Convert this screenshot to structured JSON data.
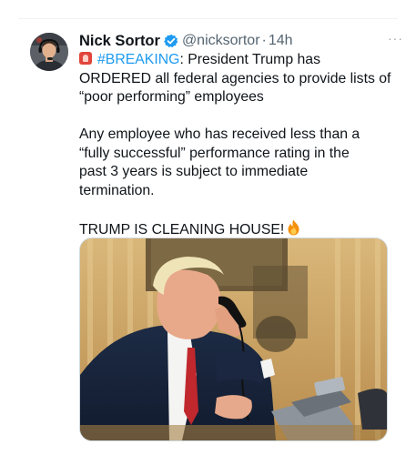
{
  "tweet": {
    "author_name": "Nick Sortor",
    "handle": "@nicksortor",
    "separator": "·",
    "time": "14h",
    "more": "···",
    "hashtag": "#BREAKING",
    "line1_rest": ": President Trump has",
    "line2": "ORDERED all federal agencies to provide lists of",
    "line3": "“poor performing” employees",
    "line4": "Any employee who has received less than a",
    "line5": "“fully successful” performance rating in the",
    "line6": "past 3 years is subject to immediate",
    "line7": "termination.",
    "line8": "TRUMP IS CLEANING HOUSE!"
  },
  "icons": {
    "verified": "verified-badge-icon",
    "siren": "rotating-light-icon",
    "fire": "fire-icon",
    "more": "more-options-icon"
  },
  "colors": {
    "link": "#1d9bf0",
    "text": "#0f1419",
    "secondary": "#536471",
    "siren": "#e0443a",
    "fire": "#f4900c"
  }
}
